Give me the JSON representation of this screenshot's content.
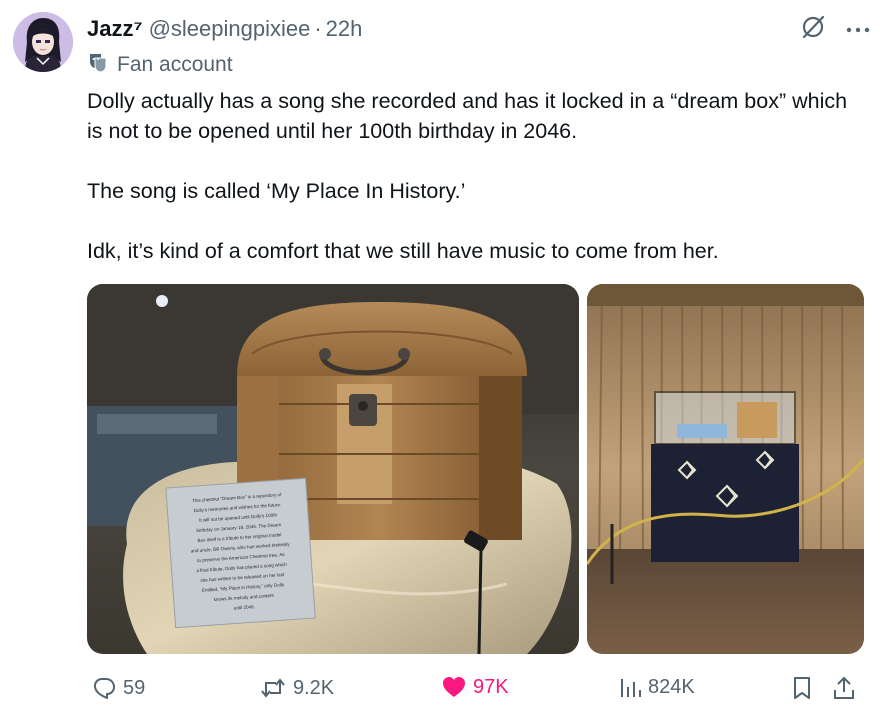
{
  "author": {
    "display_name": "Jazz⁷",
    "handle": "@sleepingpixiee",
    "separator": "·",
    "time": "22h",
    "label": "Fan account"
  },
  "tweet": {
    "paragraphs": [
      "Dolly actually has a song she recorded and has it locked in a “dream box” which is not to be opened until her 100th birthday in 2046.",
      "The song is called ‘My Place In History.’",
      "Idk, it’s kind of a comfort that we still have music to come from her."
    ]
  },
  "plaque": {
    "lines": [
      "This chestnut “Dream Box” is a repository of",
      "Dolly’s memories and wishes for the future.",
      "It will not be opened until Dolly’s 100th",
      "birthday on January 19, 2046. The Dream",
      "Box itself is a tribute to her original model",
      "and uncle, Bill Owens, who has worked tirelessly",
      "to preserve the American Chestnut tree. As",
      "a final tribute, Dolly has placed a song which",
      "she has written to be released on her last",
      "Entitled, “My Place in History,” only Dolly",
      "knows its melody and content",
      "until 2046."
    ]
  },
  "metrics": {
    "replies": "59",
    "reposts": "9.2K",
    "likes": "97K",
    "views": "824K"
  },
  "colors": {
    "text": "#0f1419",
    "secondary": "#536471",
    "like": "#f91880"
  },
  "icons": {
    "fan_badge": "theater-masks-icon",
    "grok": "grok-icon",
    "more": "more-dots-icon",
    "reply": "reply-icon",
    "repost": "repost-icon",
    "like": "heart-icon",
    "views": "views-icon",
    "bookmark": "bookmark-icon",
    "share": "share-icon"
  }
}
